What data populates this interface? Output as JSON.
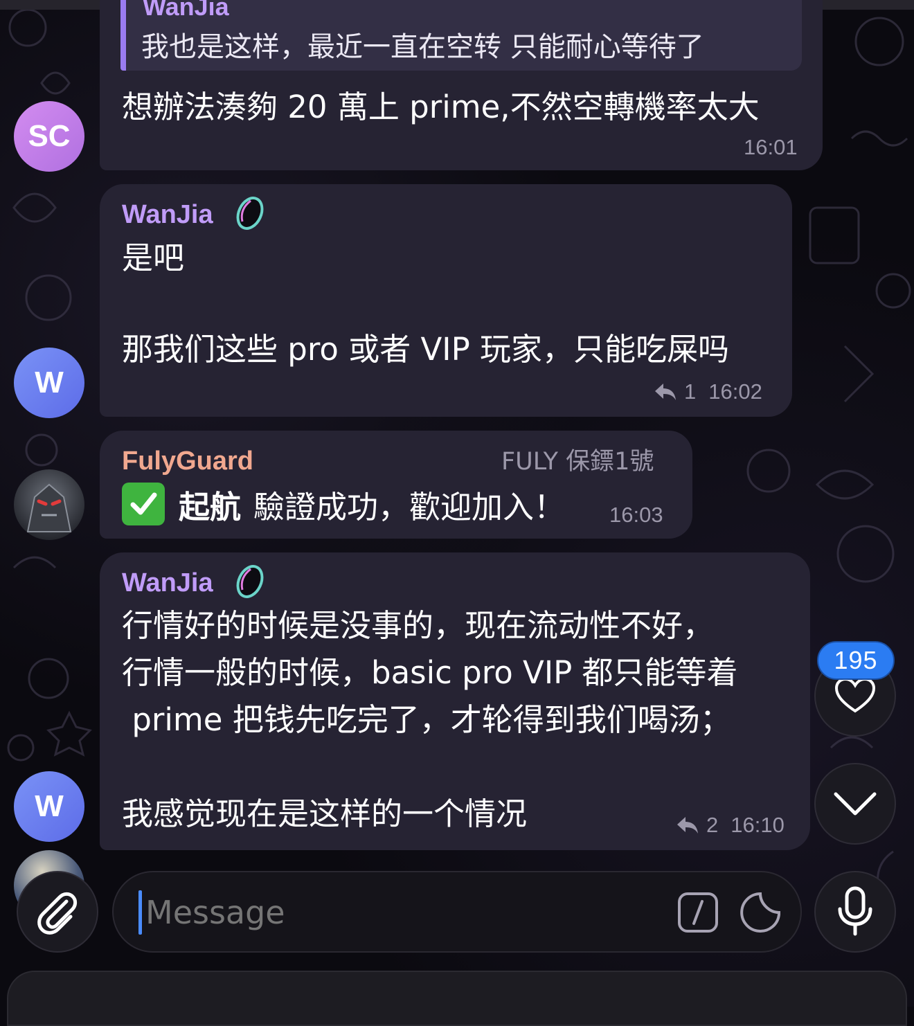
{
  "colors": {
    "accent_wanjia": "#c09cf8",
    "accent_fulyguard": "#f1a88f",
    "bubble": "#262333",
    "quote_bar": "#9a7cf0",
    "badge": "#2b7cf2",
    "avatar_sc": "#c57ee8",
    "avatar_w": "#6a7ff1"
  },
  "messages": [
    {
      "avatar": "SC",
      "quote_author": "WanJia",
      "quote_text": "我也是这样，最近一直在空转 只能耐心等待了",
      "text": "想辦法湊夠 20 萬上 prime,不然空轉機率太大",
      "time": "16:01"
    },
    {
      "avatar": "W",
      "sender": "WanJia",
      "text": "是吧\n\n那我们这些 pro 或者 VIP 玩家，只能吃屎吗",
      "reply_count": "1",
      "time": "16:02"
    },
    {
      "sender": "FulyGuard",
      "role": "FULY 保鏢1號",
      "emoji": "✅",
      "text_bold": "起航",
      "text": "驗證成功，歡迎加入！",
      "time": "16:03"
    },
    {
      "avatar": "W",
      "sender": "WanJia",
      "text": "行情好的时候是没事的，现在流动性不好，\n行情一般的时候，basic pro VIP 都只能等着\n prime 把钱先吃完了，才轮得到我们喝汤；\n\n我感觉现在是这样的一个情况",
      "reply_count": "2",
      "time": "16:10"
    }
  ],
  "reactions_badge": "195",
  "composer": {
    "placeholder": "Message"
  },
  "icons": {
    "attach": "paperclip-icon",
    "commands": "slash-command-icon",
    "sticker": "sticker-icon",
    "mic": "microphone-icon",
    "scroll_down": "chevron-down-icon",
    "reactions": "heart-icon",
    "reply": "reply-arrow-icon",
    "premium_badge": "premium-ring-icon"
  }
}
